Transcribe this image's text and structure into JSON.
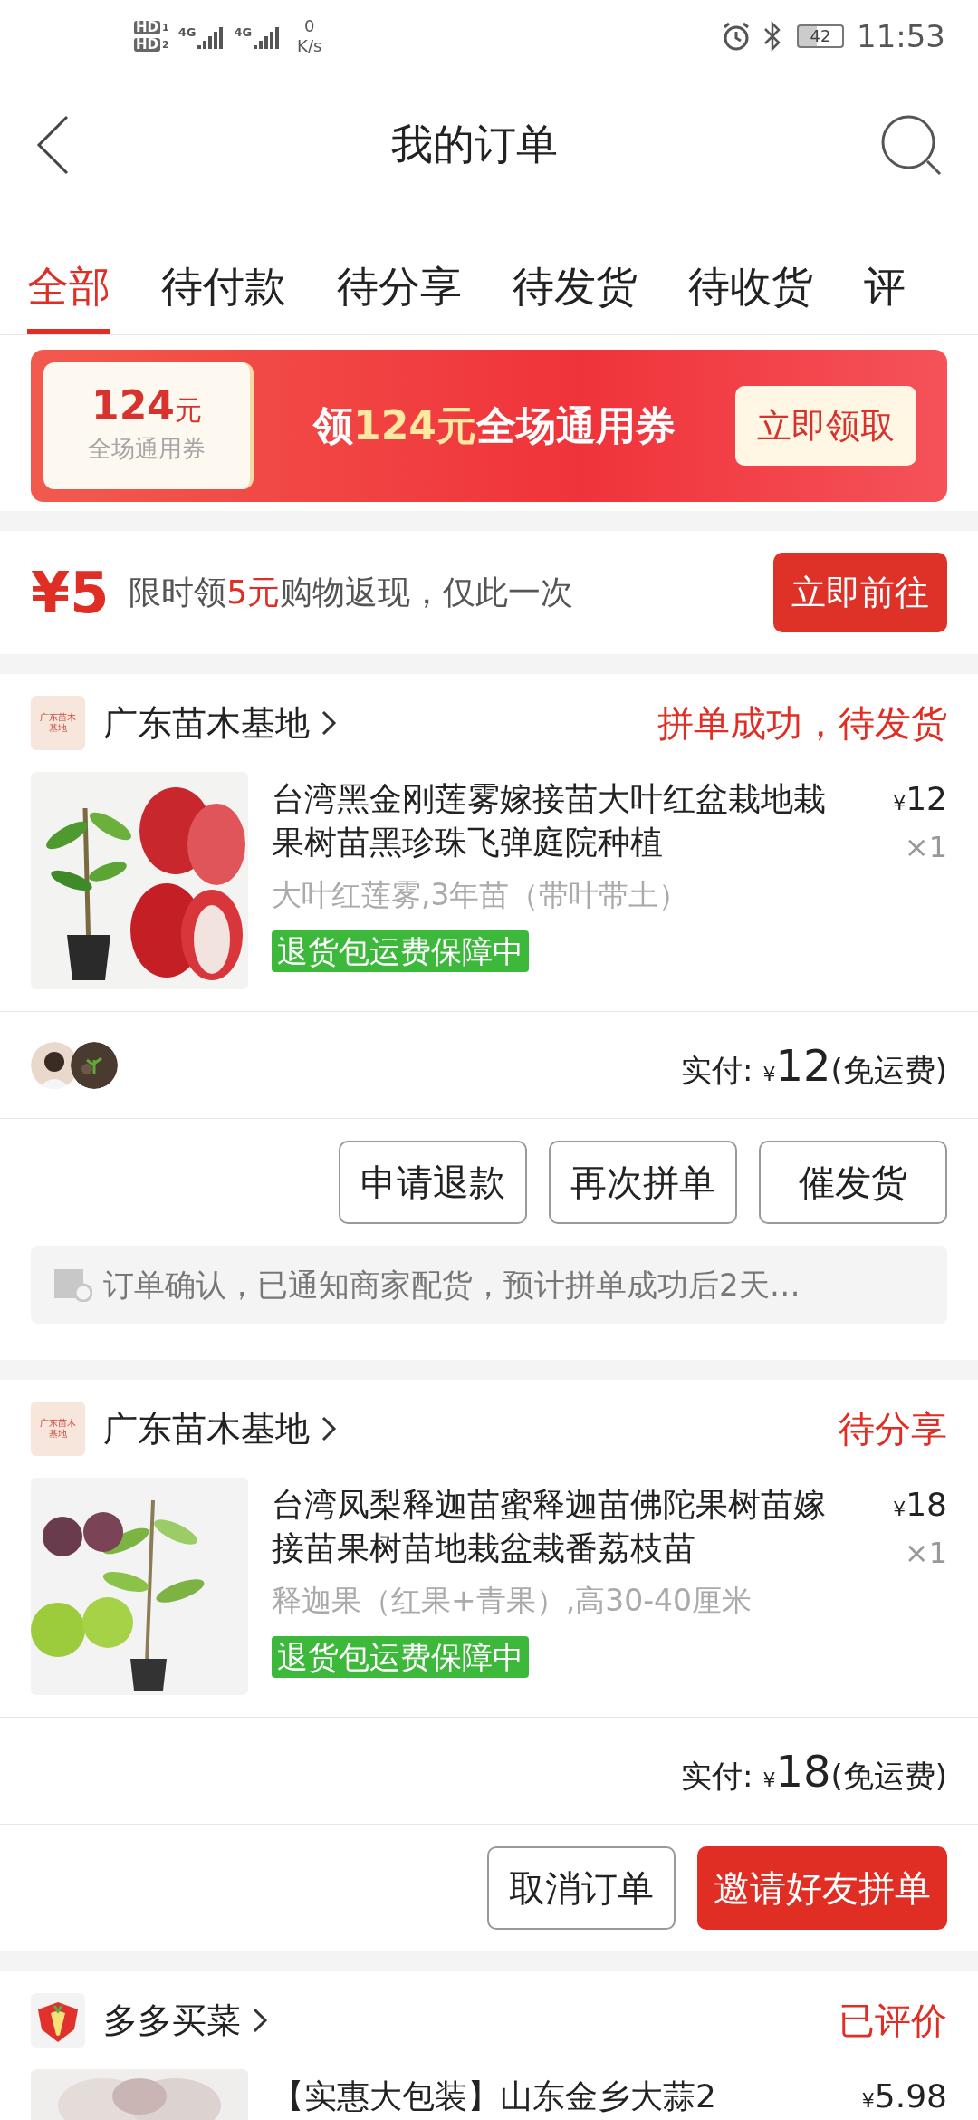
{
  "status_bar": {
    "sims": [
      {
        "label": "HD",
        "slot": "1"
      },
      {
        "label": "HD",
        "slot": "2"
      }
    ],
    "networks": [
      "4G",
      "4G"
    ],
    "speed_value": "0",
    "speed_unit": "K/s",
    "battery": "42",
    "time": "11:53"
  },
  "header": {
    "title": "我的订单"
  },
  "tabs": [
    {
      "label": "全部",
      "selected": true
    },
    {
      "label": "待付款",
      "selected": false
    },
    {
      "label": "待分享",
      "selected": false
    },
    {
      "label": "待发货",
      "selected": false
    },
    {
      "label": "待收货",
      "selected": false
    },
    {
      "label": "评",
      "selected": false
    }
  ],
  "coupon_banner": {
    "amount": "124",
    "unit": "元",
    "caption": "全场通用券",
    "headline": [
      {
        "text": "领",
        "highlight": false
      },
      {
        "text": "124元",
        "highlight": true
      },
      {
        "text": "全场通用券",
        "highlight": false
      }
    ],
    "button": "立即领取"
  },
  "cashback": {
    "amount": "¥5",
    "text": [
      {
        "text": "限时领",
        "highlight": false
      },
      {
        "text": "5元",
        "highlight": true
      },
      {
        "text": "购物返现，仅此一次",
        "highlight": false
      }
    ],
    "button": "立即前往"
  },
  "orders": [
    {
      "shop": "广东苗木基地",
      "shop_logo": {
        "kind": "text",
        "text": "广东苗木基地"
      },
      "status": "拼单成功，待发货",
      "product": {
        "title": "台湾黑金刚莲雾嫁接苗大叶红盆栽地栽果树苗黑珍珠飞弹庭院种植",
        "currency": "¥",
        "price": "12",
        "quantity": "×1",
        "spec": "大叶红莲雾,3年苗（带叶带土）",
        "badge": "退货包运费保障中"
      },
      "payment": {
        "label": "实付:",
        "currency": "¥",
        "amount": "12",
        "note": "(免运费)"
      },
      "buttons": [
        {
          "label": "申请退款",
          "kind": "outline"
        },
        {
          "label": "再次拼单",
          "kind": "outline"
        },
        {
          "label": "催发货",
          "kind": "outline"
        }
      ],
      "notice": "订单确认，已通知商家配货，预计拼单成功后2天…"
    },
    {
      "shop": "广东苗木基地",
      "shop_logo": {
        "kind": "text",
        "text": "广东苗木基地"
      },
      "status": "待分享",
      "product": {
        "title": "台湾凤梨释迦苗蜜释迦苗佛陀果树苗嫁接苗果树苗地栽盆栽番荔枝苗",
        "currency": "¥",
        "price": "18",
        "quantity": "×1",
        "spec": "释迦果（红果+青果）,高30-40厘米",
        "badge": "退货包运费保障中"
      },
      "payment": {
        "label": "实付:",
        "currency": "¥",
        "amount": "18",
        "note": "(免运费)"
      },
      "buttons": [
        {
          "label": "取消订单",
          "kind": "outline"
        },
        {
          "label": "邀请好友拼单",
          "kind": "primary"
        }
      ]
    },
    {
      "shop": "多多买菜",
      "shop_logo": {
        "kind": "carrot"
      },
      "status": "已评价",
      "product": {
        "title": "【实惠大包装】山东金乡大蒜2",
        "currency": "¥",
        "price": "5.98"
      }
    }
  ]
}
